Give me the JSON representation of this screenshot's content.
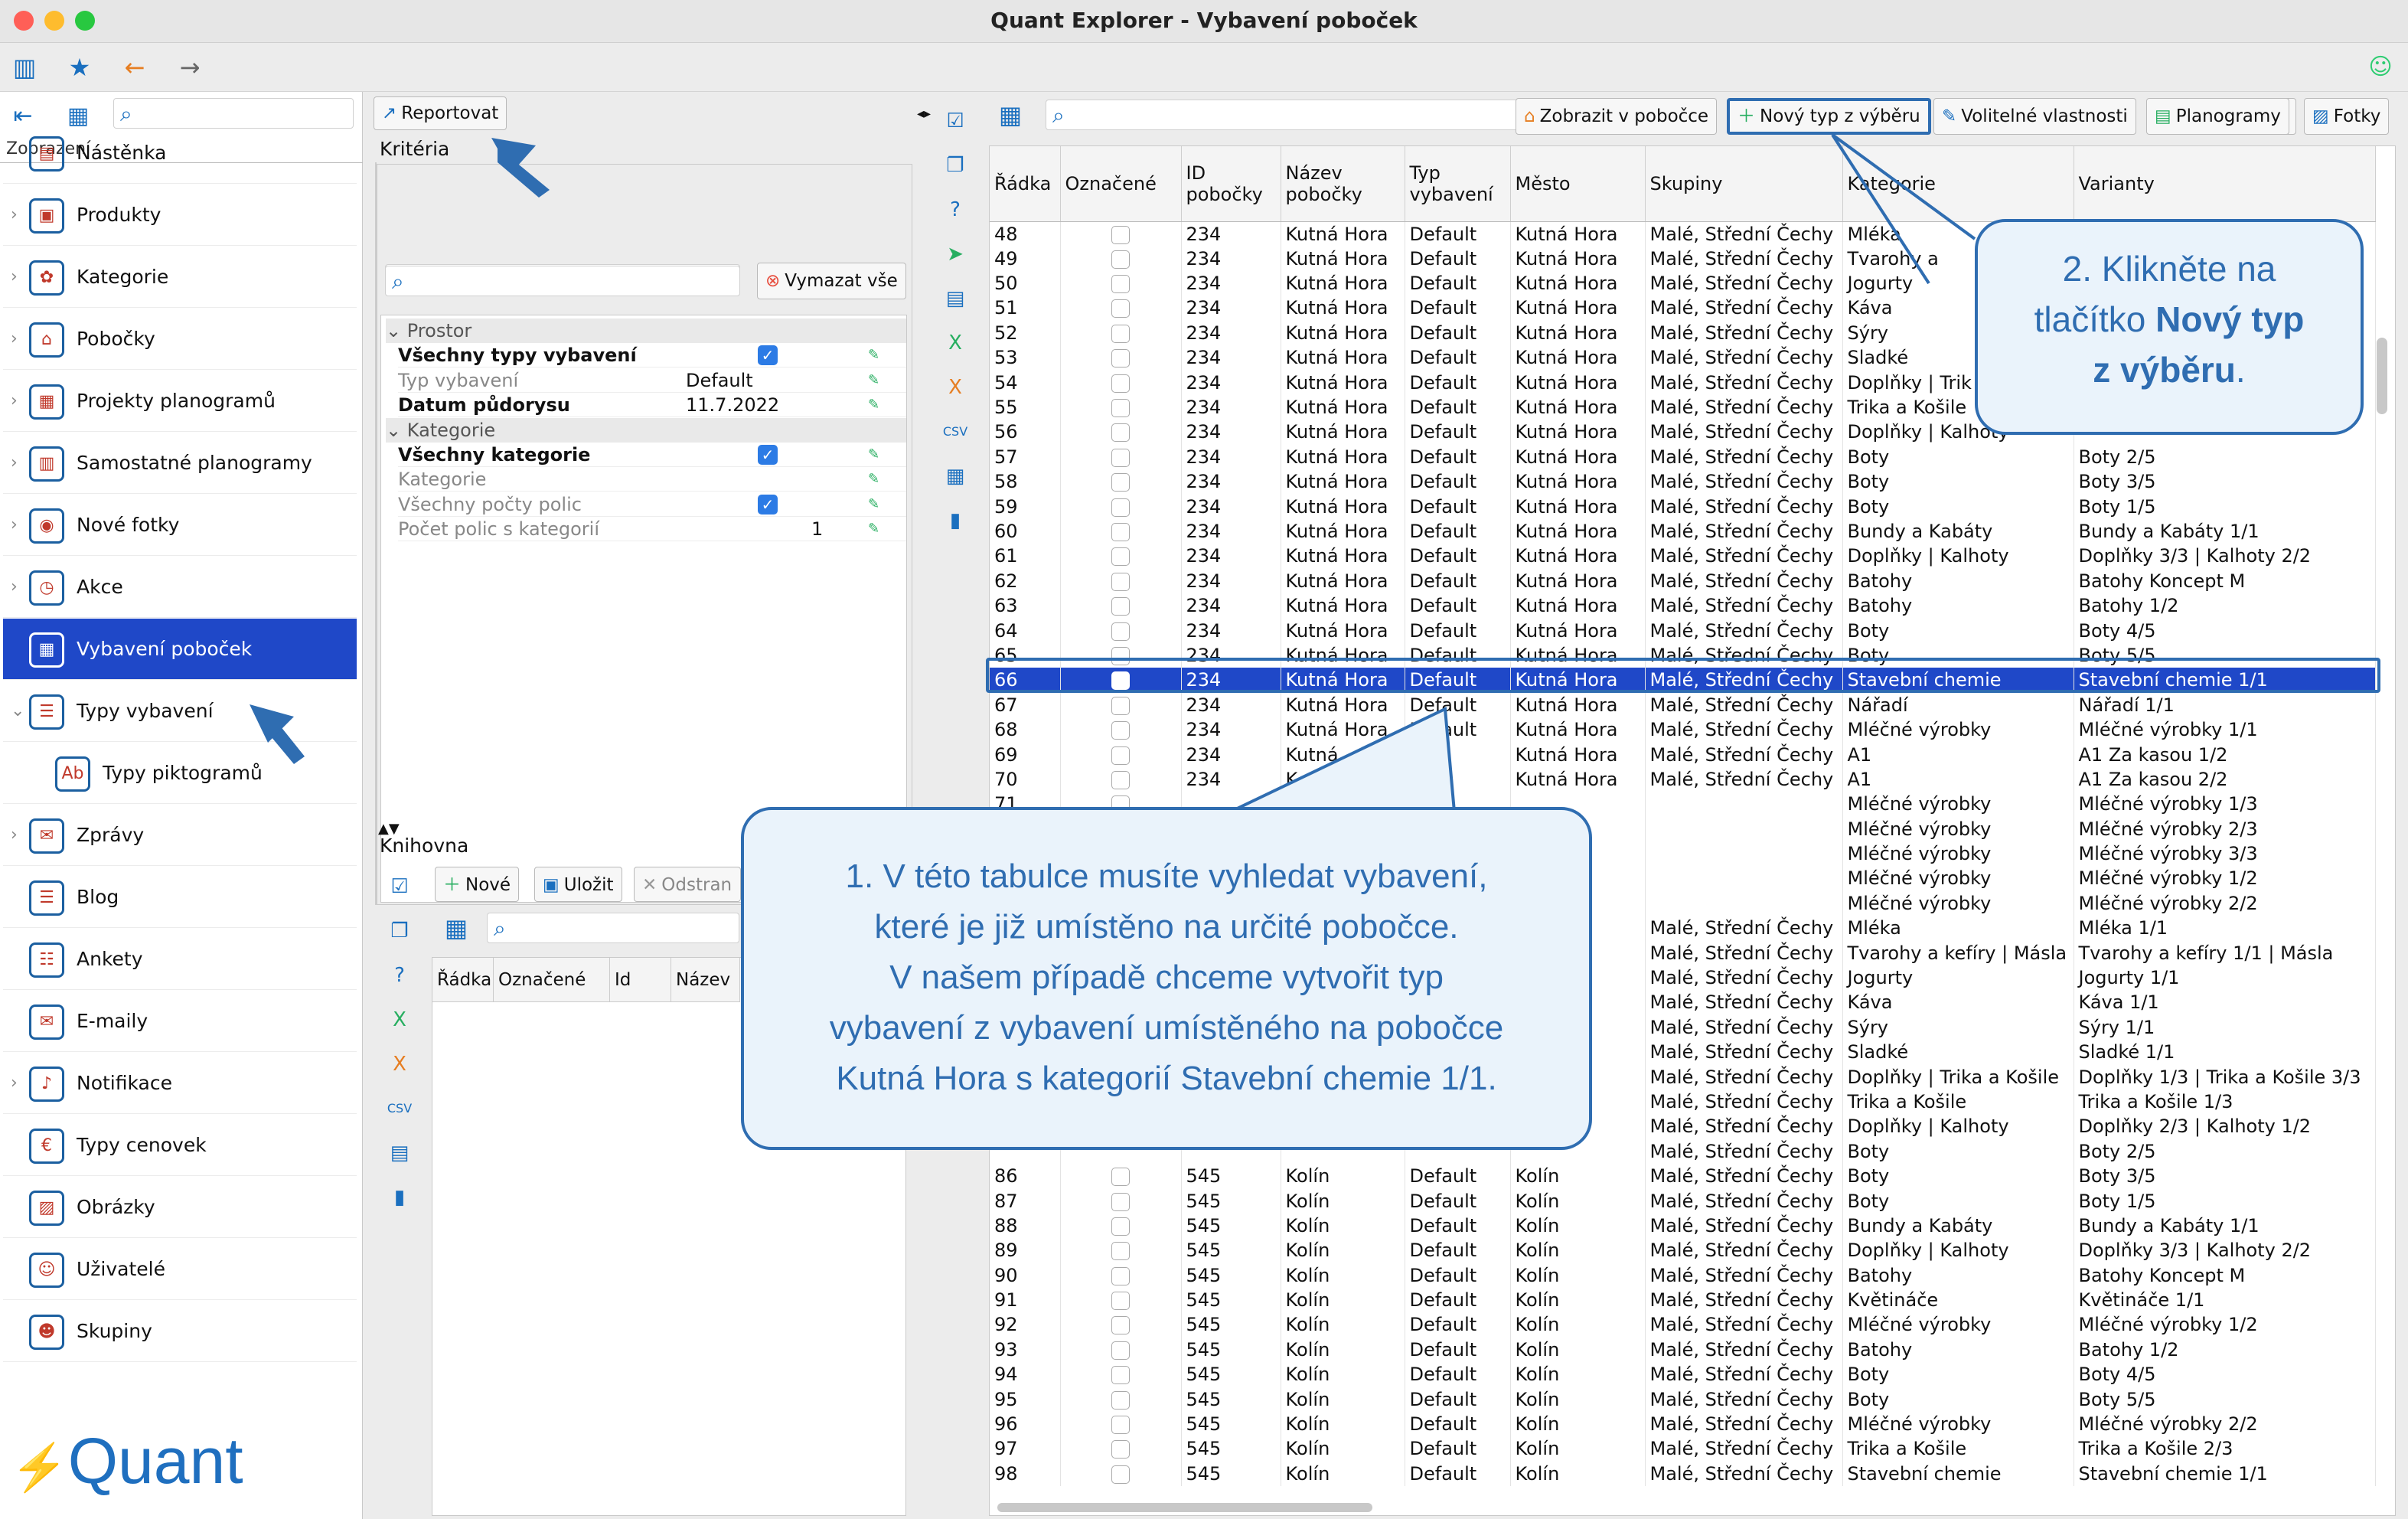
{
  "window": {
    "title": "Quant Explorer - Vybavení poboček"
  },
  "left": {
    "view_label": "Zobrazení",
    "nav": [
      {
        "label": "Nástěnka",
        "icon": "dashboard-icon",
        "chev": ""
      },
      {
        "label": "Produkty",
        "icon": "products-icon",
        "chev": "›"
      },
      {
        "label": "Kategorie",
        "icon": "categories-icon",
        "chev": "›"
      },
      {
        "label": "Pobočky",
        "icon": "branches-icon",
        "chev": "›"
      },
      {
        "label": "Projekty planogramů",
        "icon": "planogram-projects-icon",
        "chev": "›"
      },
      {
        "label": "Samostatné planogramy",
        "icon": "planograms-icon",
        "chev": "›"
      },
      {
        "label": "Nové fotky",
        "icon": "camera-icon",
        "chev": "›"
      },
      {
        "label": "Akce",
        "icon": "clock-icon",
        "chev": "›"
      },
      {
        "label": "Vybavení poboček",
        "icon": "equipment-icon",
        "chev": "",
        "selected": true
      },
      {
        "label": "Typy vybavení",
        "icon": "equipment-types-icon",
        "chev": "⌄"
      },
      {
        "label": "Typy piktogramů",
        "icon": "pictogram-icon",
        "chev": "",
        "indent": true
      },
      {
        "label": "Zprávy",
        "icon": "messages-icon",
        "chev": "›"
      },
      {
        "label": "Blog",
        "icon": "blog-icon",
        "chev": ""
      },
      {
        "label": "Ankety",
        "icon": "survey-icon",
        "chev": ""
      },
      {
        "label": "E-maily",
        "icon": "email-icon",
        "chev": ""
      },
      {
        "label": "Notifikace",
        "icon": "bell-icon",
        "chev": "›"
      },
      {
        "label": "Typy cenovek",
        "icon": "price-tag-icon",
        "chev": ""
      },
      {
        "label": "Obrázky",
        "icon": "image-icon",
        "chev": ""
      },
      {
        "label": "Uživatelé",
        "icon": "user-icon",
        "chev": ""
      },
      {
        "label": "Skupiny",
        "icon": "groups-icon",
        "chev": ""
      }
    ],
    "logo": "Quant"
  },
  "middle": {
    "report_btn": "Reportovat",
    "criteria_title": "Kritéria",
    "clear_all": "Vymazat vše",
    "groups": [
      {
        "label": "Prostor"
      },
      {
        "label": "Kategorie"
      }
    ],
    "rows": [
      {
        "label": "Všechny typy vybavení",
        "bold": true,
        "check": true,
        "value": ""
      },
      {
        "label": "Typ vybavení",
        "bold": false,
        "check": false,
        "value": "Default"
      },
      {
        "label": "Datum půdorysu",
        "bold": true,
        "check": false,
        "value": "11.7.2022"
      },
      {
        "label": "Všechny kategorie",
        "bold": true,
        "check": true,
        "value": ""
      },
      {
        "label": "Kategorie",
        "bold": false,
        "check": false,
        "value": ""
      },
      {
        "label": "Všechny počty polic",
        "bold": false,
        "check": true,
        "value": ""
      },
      {
        "label": "Počet polic s kategorií",
        "bold": false,
        "check": false,
        "value": "1"
      }
    ],
    "library_title": "Knihovna",
    "lib_new": "Nové",
    "lib_save": "Uložit",
    "lib_delete": "Odstran",
    "lib_cols": [
      "Řádka",
      "Označené",
      "Id",
      "Název"
    ]
  },
  "right": {
    "toolbar": {
      "show_in_branch": "Zobrazit v pobočce",
      "new_type": "Nový typ z výběru",
      "optional_props": "Volitelné vlastnosti",
      "planograms": "Planogramy",
      "photos": "Fotky"
    },
    "columns": [
      "Řádka",
      "Označené",
      "ID pobočky",
      "Název pobočky",
      "Typ vybavení",
      "Město",
      "Skupiny",
      "Kategorie",
      "Varianty"
    ],
    "rows": [
      [
        "48",
        "234",
        "Kutná Hora",
        "Default",
        "Kutná Hora",
        "Malé, Střední Čechy",
        "Mléka",
        ""
      ],
      [
        "49",
        "234",
        "Kutná Hora",
        "Default",
        "Kutná Hora",
        "Malé, Střední Čechy",
        "Tvarohy a",
        ""
      ],
      [
        "50",
        "234",
        "Kutná Hora",
        "Default",
        "Kutná Hora",
        "Malé, Střední Čechy",
        "Jogurty",
        ""
      ],
      [
        "51",
        "234",
        "Kutná Hora",
        "Default",
        "Kutná Hora",
        "Malé, Střední Čechy",
        "Kávа",
        ""
      ],
      [
        "52",
        "234",
        "Kutná Hora",
        "Default",
        "Kutná Hora",
        "Malé, Střední Čechy",
        "Sýry",
        ""
      ],
      [
        "53",
        "234",
        "Kutná Hora",
        "Default",
        "Kutná Hora",
        "Malé, Střední Čechy",
        "Sladké",
        ""
      ],
      [
        "54",
        "234",
        "Kutná Hora",
        "Default",
        "Kutná Hora",
        "Malé, Střední Čechy",
        "Doplňky | Trik",
        ""
      ],
      [
        "55",
        "234",
        "Kutná Hora",
        "Default",
        "Kutná Hora",
        "Malé, Střední Čechy",
        "Trika a Košile",
        ""
      ],
      [
        "56",
        "234",
        "Kutná Hora",
        "Default",
        "Kutná Hora",
        "Malé, Střední Čechy",
        "Doplňky | Kalhoty",
        ""
      ],
      [
        "57",
        "234",
        "Kutná Hora",
        "Default",
        "Kutná Hora",
        "Malé, Střední Čechy",
        "Boty",
        "Boty 2/5"
      ],
      [
        "58",
        "234",
        "Kutná Hora",
        "Default",
        "Kutná Hora",
        "Malé, Střední Čechy",
        "Boty",
        "Boty 3/5"
      ],
      [
        "59",
        "234",
        "Kutná Hora",
        "Default",
        "Kutná Hora",
        "Malé, Střední Čechy",
        "Boty",
        "Boty 1/5"
      ],
      [
        "60",
        "234",
        "Kutná Hora",
        "Default",
        "Kutná Hora",
        "Malé, Střední Čechy",
        "Bundy a Kabáty",
        "Bundy a Kabáty 1/1"
      ],
      [
        "61",
        "234",
        "Kutná Hora",
        "Default",
        "Kutná Hora",
        "Malé, Střední Čechy",
        "Doplňky | Kalhoty",
        "Doplňky 3/3 | Kalhoty 2/2"
      ],
      [
        "62",
        "234",
        "Kutná Hora",
        "Default",
        "Kutná Hora",
        "Malé, Střední Čechy",
        "Batohy",
        "Batohy Koncept M"
      ],
      [
        "63",
        "234",
        "Kutná Hora",
        "Default",
        "Kutná Hora",
        "Malé, Střední Čechy",
        "Batohy",
        "Batohy 1/2"
      ],
      [
        "64",
        "234",
        "Kutná Hora",
        "Default",
        "Kutná Hora",
        "Malé, Střední Čechy",
        "Boty",
        "Boty 4/5"
      ],
      [
        "65",
        "234",
        "Kutná Hora",
        "Default",
        "Kutná Hora",
        "Malé, Střední Čechy",
        "Boty",
        "Boty 5/5"
      ],
      [
        "66",
        "234",
        "Kutná Hora",
        "Default",
        "Kutná Hora",
        "Malé, Střední Čechy",
        "Stavební chemie",
        "Stavební chemie 1/1"
      ],
      [
        "67",
        "234",
        "Kutná Hora",
        "Default",
        "Kutná Hora",
        "Malé, Střední Čechy",
        "Nářadí",
        "Nářadí 1/1"
      ],
      [
        "68",
        "234",
        "Kutná Hora",
        "Default",
        "Kutná Hora",
        "Malé, Střední Čechy",
        "Mléčné výrobky",
        "Mléčné výrobky 1/1"
      ],
      [
        "69",
        "234",
        "Kutná",
        "A1",
        "Kutná Hora",
        "Malé, Střední Čechy",
        "A1",
        "A1 Za kasou 1/2"
      ],
      [
        "70",
        "234",
        "K",
        "A1",
        "Kutná Hora",
        "Malé, Střední Čechy",
        "A1",
        "A1 Za kasou 2/2"
      ],
      [
        "71",
        "",
        "",
        "ult",
        "",
        "",
        "Mléčné výrobky",
        "Mléčné výrobky 1/3"
      ],
      [
        "",
        "",
        "",
        "",
        "",
        "",
        "Mléčné výrobky",
        "Mléčné výrobky 2/3"
      ],
      [
        "",
        "",
        "",
        "",
        "",
        "",
        "Mléčné výrobky",
        "Mléčné výrobky 3/3"
      ],
      [
        "",
        "",
        "",
        "",
        "",
        "",
        "Mléčné výrobky",
        "Mléčné výrobky 1/2"
      ],
      [
        "",
        "",
        "",
        "",
        "",
        "",
        "Mléčné výrobky",
        "Mléčné výrobky 2/2"
      ],
      [
        "",
        "",
        "",
        "",
        "",
        "Malé, Střední Čechy",
        "Mléka",
        "Mléka 1/1"
      ],
      [
        "",
        "",
        "",
        "",
        "",
        "Malé, Střední Čechy",
        "Tvarohy a kefíry | Másla",
        "Tvarohy a kefíry 1/1 | Másla"
      ],
      [
        "",
        "",
        "",
        "",
        "",
        "Malé, Střední Čechy",
        "Jogurty",
        "Jogurty 1/1"
      ],
      [
        "",
        "",
        "",
        "",
        "",
        "Malé, Střední Čechy",
        "Káva",
        "Káva 1/1"
      ],
      [
        "",
        "",
        "",
        "",
        "",
        "Malé, Střední Čechy",
        "Sýry",
        "Sýry 1/1"
      ],
      [
        "",
        "",
        "",
        "",
        "",
        "Malé, Střední Čechy",
        "Sladké",
        "Sladké 1/1"
      ],
      [
        "",
        "",
        "",
        "",
        "",
        "Malé, Střední Čechy",
        "Doplňky | Trika a Košile",
        "Doplňky 1/3 | Trika a Košile 3/3"
      ],
      [
        "",
        "",
        "",
        "",
        "",
        "Malé, Střední Čechy",
        "Trika a Košile",
        "Trika a Košile 1/3"
      ],
      [
        "",
        "",
        "",
        "",
        "",
        "Malé, Střední Čechy",
        "Doplňky | Kalhoty",
        "Doplňky 2/3 | Kalhoty 1/2"
      ],
      [
        "",
        "",
        "",
        "",
        "",
        "Malé, Střední Čechy",
        "Boty",
        "Boty 2/5"
      ],
      [
        "86",
        "545",
        "Kolín",
        "Default",
        "Kolín",
        "Malé, Střední Čechy",
        "Boty",
        "Boty 3/5"
      ],
      [
        "87",
        "545",
        "Kolín",
        "Default",
        "Kolín",
        "Malé, Střední Čechy",
        "Boty",
        "Boty 1/5"
      ],
      [
        "88",
        "545",
        "Kolín",
        "Default",
        "Kolín",
        "Malé, Střední Čechy",
        "Bundy a Kabáty",
        "Bundy a Kabáty 1/1"
      ],
      [
        "89",
        "545",
        "Kolín",
        "Default",
        "Kolín",
        "Malé, Střední Čechy",
        "Doplňky | Kalhoty",
        "Doplňky 3/3 | Kalhoty 2/2"
      ],
      [
        "90",
        "545",
        "Kolín",
        "Default",
        "Kolín",
        "Malé, Střední Čechy",
        "Batohy",
        "Batohy Koncept M"
      ],
      [
        "91",
        "545",
        "Kolín",
        "Default",
        "Kolín",
        "Malé, Střední Čechy",
        "Květináče",
        "Květináče 1/1"
      ],
      [
        "92",
        "545",
        "Kolín",
        "Default",
        "Kolín",
        "Malé, Střední Čechy",
        "Mléčné výrobky",
        "Mléčné výrobky 1/2"
      ],
      [
        "93",
        "545",
        "Kolín",
        "Default",
        "Kolín",
        "Malé, Střední Čechy",
        "Batohy",
        "Batohy 1/2"
      ],
      [
        "94",
        "545",
        "Kolín",
        "Default",
        "Kolín",
        "Malé, Střední Čechy",
        "Boty",
        "Boty 4/5"
      ],
      [
        "95",
        "545",
        "Kolín",
        "Default",
        "Kolín",
        "Malé, Střední Čechy",
        "Boty",
        "Boty 5/5"
      ],
      [
        "96",
        "545",
        "Kolín",
        "Default",
        "Kolín",
        "Malé, Střední Čechy",
        "Mléčné výrobky",
        "Mléčné výrobky 2/2"
      ],
      [
        "97",
        "545",
        "Kolín",
        "Default",
        "Kolín",
        "Malé, Střední Čechy",
        "Trika a Košile",
        "Trika a Košile 2/3"
      ],
      [
        "98",
        "545",
        "Kolín",
        "Default",
        "Kolín",
        "Malé, Střední Čechy",
        "Stavební chemie",
        "Stavební chemie 1/1"
      ]
    ],
    "selected_row": "66"
  },
  "callouts": {
    "one": {
      "lines": [
        "1. V této tabulce musíte vyhledat vybavení,",
        "které je již umístěno na určité pobočce.",
        "V našem případě chceme vytvořit typ",
        "vybavení z vybavení umístěného na pobočce",
        "Kutná Hora s kategorií Stavební chemie 1/1."
      ]
    },
    "two": {
      "pre": "2. Klikněte na",
      "mid_pre": "tlačítko ",
      "mid_bold": "Nový typ",
      "post_bold": "z výběru",
      "post": "."
    }
  },
  "colors": {
    "accent": "#1f48c8",
    "callout_border": "#2f6db1",
    "callout_bg": "#eaf3fb"
  }
}
